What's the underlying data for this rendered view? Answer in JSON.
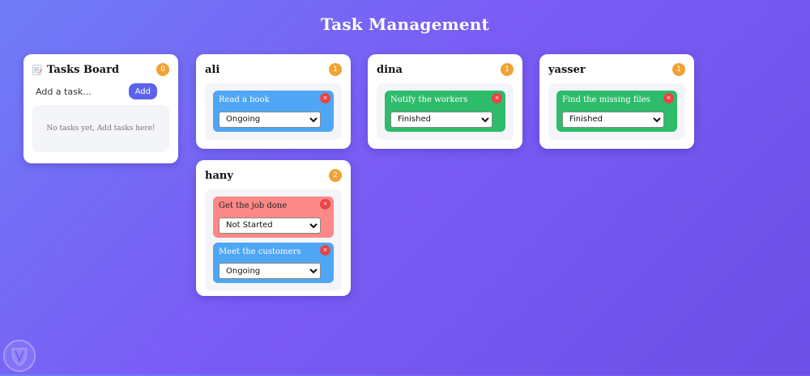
{
  "page": {
    "title": "Task Management"
  },
  "board": {
    "icon": "memo-icon",
    "title": "Tasks Board",
    "count": "0",
    "input_placeholder": "Add a task...",
    "add_label": "Add",
    "empty_text": "No tasks yet, Add tasks here!"
  },
  "columns": [
    {
      "name": "ali",
      "count": "1",
      "tasks": [
        {
          "title": "Read a book",
          "status": "Ongoing",
          "delete_label": "×"
        }
      ]
    },
    {
      "name": "dina",
      "count": "1",
      "tasks": [
        {
          "title": "Notify the workers",
          "status": "Finished",
          "delete_label": "×"
        }
      ]
    },
    {
      "name": "yasser",
      "count": "1",
      "tasks": [
        {
          "title": "Find the missing files",
          "status": "Finished",
          "delete_label": "×"
        }
      ]
    },
    {
      "name": "hany",
      "count": "2",
      "tasks": [
        {
          "title": "Get the job done",
          "status": "Not Started",
          "delete_label": "×"
        },
        {
          "title": "Meet the customers",
          "status": "Ongoing",
          "delete_label": "×"
        }
      ]
    }
  ],
  "status_colors": {
    "Ongoing": "#4fa6f4",
    "Finished": "#2ebc6b",
    "Not Started": "#fc8888"
  },
  "watermark": {
    "icon": "shield-logo-icon"
  }
}
